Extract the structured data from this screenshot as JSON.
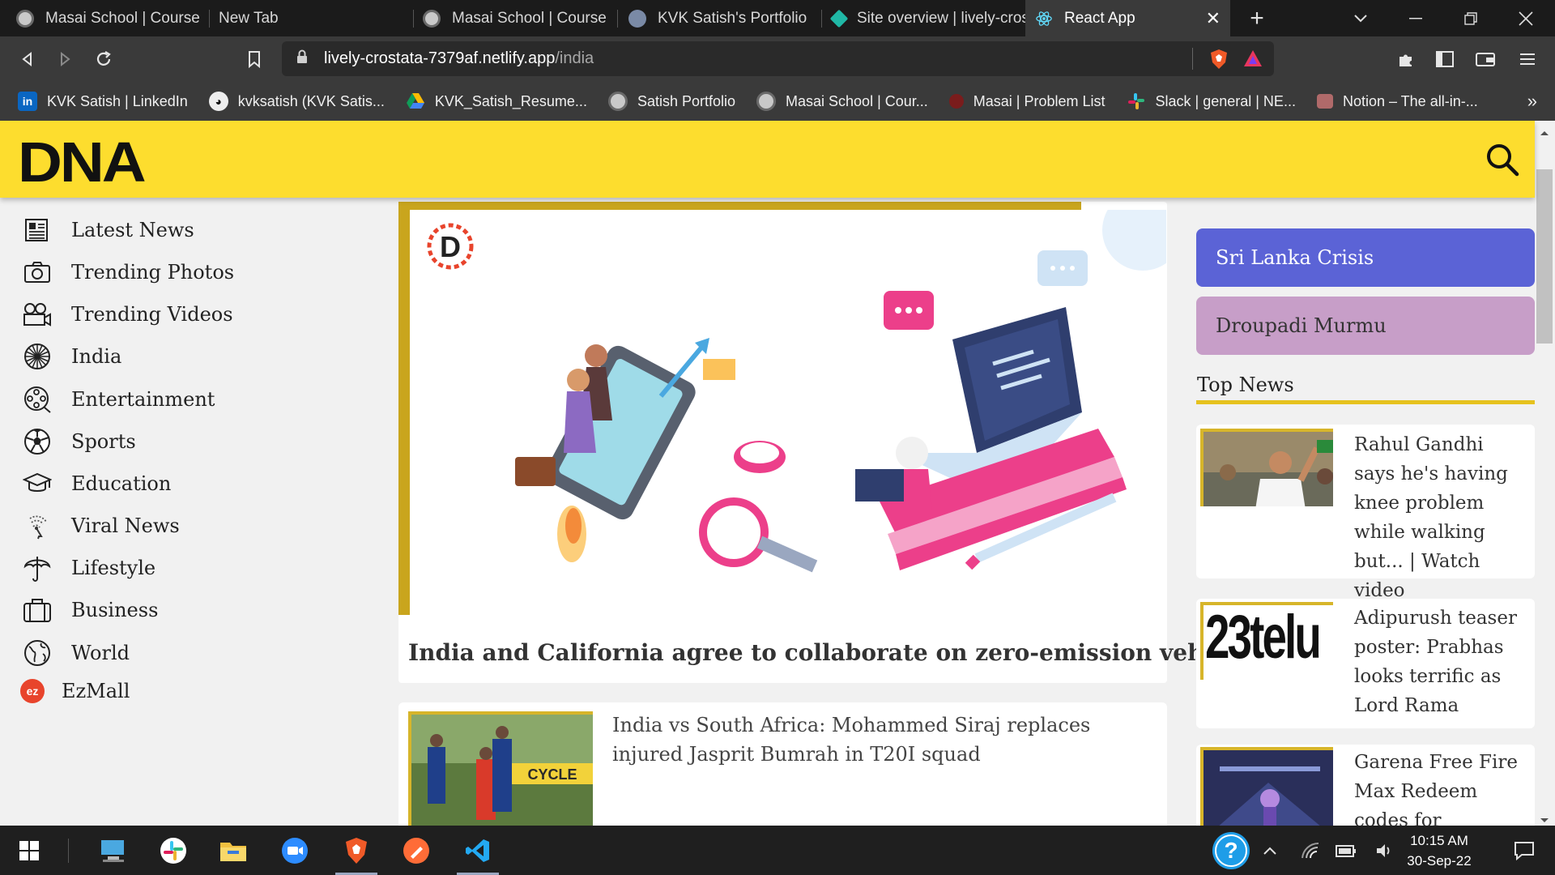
{
  "browser": {
    "tabs": [
      {
        "title": "Masai School | Course",
        "icon": "globe-icon"
      },
      {
        "title": "New Tab",
        "icon": ""
      },
      {
        "title": "Masai School | Course",
        "icon": "globe-icon"
      },
      {
        "title": "KVK Satish's Portfolio",
        "icon": "avatar-icon"
      },
      {
        "title": "Site overview | lively-cros",
        "icon": "netlify-icon"
      },
      {
        "title": "React App",
        "icon": "react-icon"
      }
    ],
    "url_host": "lively-crostata-7379af.netlify.app",
    "url_path": "/india",
    "bookmarks": [
      {
        "label": "KVK Satish | LinkedIn",
        "icon": "linkedin-icon"
      },
      {
        "label": "kvksatish (KVK Satis...",
        "icon": "github-icon"
      },
      {
        "label": "KVK_Satish_Resume...",
        "icon": "google-drive-icon"
      },
      {
        "label": "Satish Portfolio",
        "icon": "globe-icon"
      },
      {
        "label": "Masai School | Cour...",
        "icon": "globe-icon"
      },
      {
        "label": "Masai | Problem List",
        "icon": "masai-icon"
      },
      {
        "label": "Slack | general | NE...",
        "icon": "slack-icon"
      },
      {
        "label": "Notion – The all-in-...",
        "icon": "notion-icon"
      }
    ],
    "more_bookmarks": "»"
  },
  "site": {
    "logo": "DNA",
    "brand_color": "#fddd2e"
  },
  "sidebar": {
    "items": [
      {
        "label": "Latest News",
        "icon": "newspaper-icon"
      },
      {
        "label": "Trending Photos",
        "icon": "camera-icon"
      },
      {
        "label": "Trending Videos",
        "icon": "video-camera-icon"
      },
      {
        "label": "India",
        "icon": "ashoka-chakra-icon"
      },
      {
        "label": "Entertainment",
        "icon": "film-reel-icon"
      },
      {
        "label": "Sports",
        "icon": "football-icon"
      },
      {
        "label": "Education",
        "icon": "graduation-cap-icon"
      },
      {
        "label": "Viral News",
        "icon": "viral-icon"
      },
      {
        "label": "Lifestyle",
        "icon": "umbrella-icon"
      },
      {
        "label": "Business",
        "icon": "briefcase-icon"
      },
      {
        "label": "World",
        "icon": "globe-icon"
      },
      {
        "label": "EzMall",
        "icon": "ezmall-icon"
      }
    ]
  },
  "main": {
    "hero_title": "India and California agree to collaborate on zero-emission vehicles",
    "story2_title": "India vs South Africa: Mohammed Siraj replaces injured Jasprit Bumrah in T20I squad"
  },
  "right": {
    "topics": [
      {
        "label": "Sri Lanka Crisis",
        "bg": "#5b63d6",
        "fg": "#ffffff"
      },
      {
        "label": "Droupadi Murmu",
        "bg": "#c79ec8",
        "fg": "#333333"
      }
    ],
    "top_news_heading": "Top News",
    "top_news": [
      {
        "title": "Rahul Gandhi says he's having knee problem while walking but... | Watch video"
      },
      {
        "title": "Adipurush teaser poster: Prabhas looks terrific as Lord Rama",
        "thumb_text": "23telu"
      },
      {
        "title": "Garena Free Fire Max Redeem codes for"
      }
    ]
  },
  "taskbar": {
    "time": "10:15 AM",
    "date": "30-Sep-22"
  }
}
